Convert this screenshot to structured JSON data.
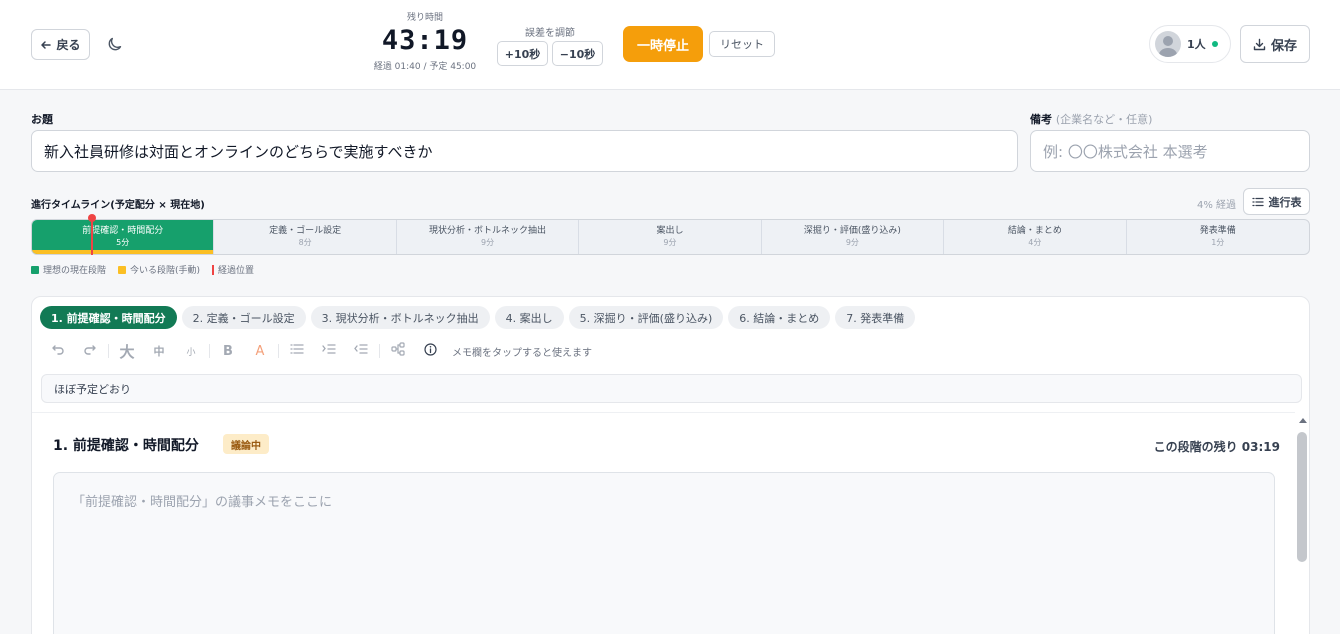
{
  "header": {
    "back_label": "戻る",
    "timer_label": "残り時間",
    "timer_value": "43:19",
    "timer_sub": "経過 01:40 / 予定 45:00",
    "adjust_label": "誤差を調節",
    "plus_label": "+10秒",
    "minus_label": "−10秒",
    "pause_label": "一時停止",
    "reset_label": "リセット",
    "users_count": "1人",
    "save_label": "保存"
  },
  "topic": {
    "label": "お題",
    "value": "新入社員研修は対面とオンラインのどちらで実施すべきか"
  },
  "note": {
    "label": "備考",
    "hint": "(企業名など・任意)",
    "placeholder": "例: 〇〇株式会社 本選考"
  },
  "timeline": {
    "title": "進行タイムライン(予定配分 × 現在地)",
    "progress_text": "4% 経過",
    "progress_percent": 4,
    "schedule_label": "進行表",
    "segments": [
      {
        "name": "前提確認・時間配分",
        "minutes": "5分",
        "weight": 5,
        "active": true
      },
      {
        "name": "定義・ゴール設定",
        "minutes": "8分",
        "weight": 8,
        "active": false
      },
      {
        "name": "現状分析・ボトルネック抽出",
        "minutes": "9分",
        "weight": 9,
        "active": false
      },
      {
        "name": "案出し",
        "minutes": "9分",
        "weight": 9,
        "active": false
      },
      {
        "name": "深掘り・評価(盛り込み)",
        "minutes": "9分",
        "weight": 9,
        "active": false
      },
      {
        "name": "結論・まとめ",
        "minutes": "4分",
        "weight": 4,
        "active": false
      },
      {
        "name": "発表準備",
        "minutes": "1分",
        "weight": 1,
        "active": false
      }
    ],
    "legend": {
      "ideal": "理想の現在段階",
      "current": "今いる段階(手動)",
      "elapsed": "経過位置"
    },
    "colors": {
      "ideal": "#16a06c",
      "current": "#fbbf24",
      "elapsed": "#ef4444"
    }
  },
  "tabs": [
    "1. 前提確認・時間配分",
    "2. 定義・ゴール設定",
    "3. 現状分析・ボトルネック抽出",
    "4. 案出し",
    "5. 深掘り・評価(盛り込み)",
    "6. 結論・まとめ",
    "7. 発表準備"
  ],
  "toolbar": {
    "large": "大",
    "medium": "中",
    "small": "小",
    "bold": "B",
    "color": "A",
    "hint": "メモ欄をタップすると使えます"
  },
  "summary_value": "ほぼ予定どおり",
  "stage": {
    "title": "1. 前提確認・時間配分",
    "badge": "議論中",
    "remaining": "この段階の残り 03:19",
    "memo_placeholder": "「前提確認・時間配分」の議事メモをここに"
  }
}
